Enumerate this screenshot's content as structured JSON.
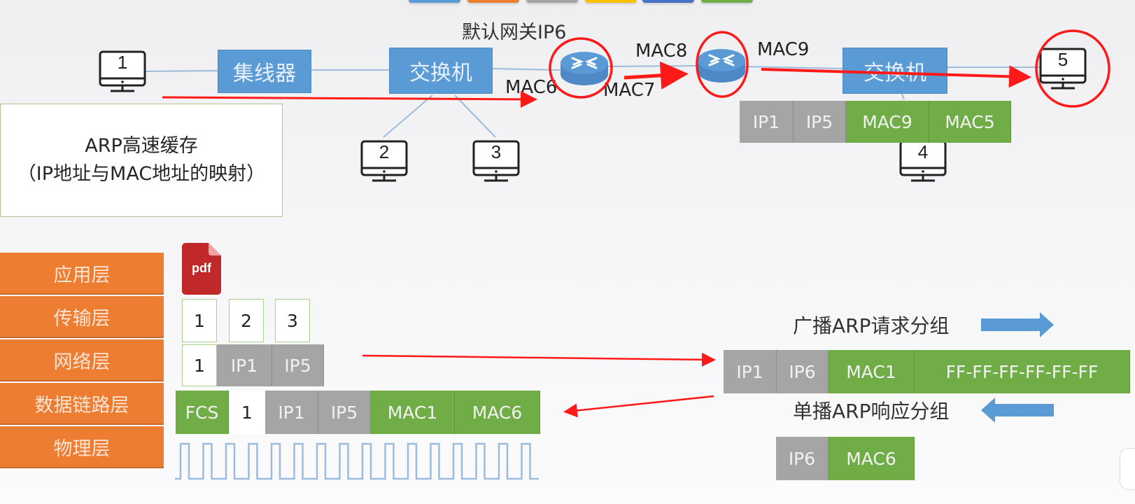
{
  "colors": {
    "accent_blue": "#5b9bd5",
    "layer_orange": "#ed7d31",
    "ip_grey": "#a5a5a5",
    "mac_green": "#70ad47",
    "annotation_red": "#ff1a1a"
  },
  "top_tabs": [
    {
      "color": "#5b9bd5"
    },
    {
      "color": "#ed7d31"
    },
    {
      "color": "#a5a5a5"
    },
    {
      "color": "#ffc000"
    },
    {
      "color": "#4472c4"
    },
    {
      "color": "#70ad47"
    }
  ],
  "topology": {
    "gateway_label": "默认网关IP6",
    "hub_label": "集线器",
    "switch_left_label": "交换机",
    "switch_right_label": "交换机",
    "hosts": [
      "1",
      "2",
      "3",
      "4",
      "5"
    ],
    "router_interfaces": {
      "r1_left": "MAC6",
      "r1_right": "MAC7",
      "r2_left": "MAC8",
      "r2_right": "MAC9"
    },
    "forwarded_frame": [
      "IP1",
      "IP5",
      "MAC9",
      "MAC5"
    ]
  },
  "arp_cache": {
    "title": "ARP高速缓存",
    "subtitle": "（IP地址与MAC地址的映射）"
  },
  "layers": [
    "应用层",
    "传输层",
    "网络层",
    "数据链路层",
    "物理层"
  ],
  "encapsulation": {
    "app_icon_label": "pdf",
    "transport_segments": [
      "1",
      "2",
      "3"
    ],
    "network_packet": [
      "1",
      "IP1",
      "IP5"
    ],
    "link_frame": [
      "FCS",
      "1",
      "IP1",
      "IP5",
      "MAC1",
      "MAC6"
    ]
  },
  "arp": {
    "request_label": "广播ARP请求分组",
    "request_packet": [
      "IP1",
      "IP6",
      "MAC1",
      "FF-FF-FF-FF-FF-FF"
    ],
    "reply_label": "单播ARP响应分组",
    "reply_packet": [
      "IP6",
      "MAC6"
    ]
  }
}
